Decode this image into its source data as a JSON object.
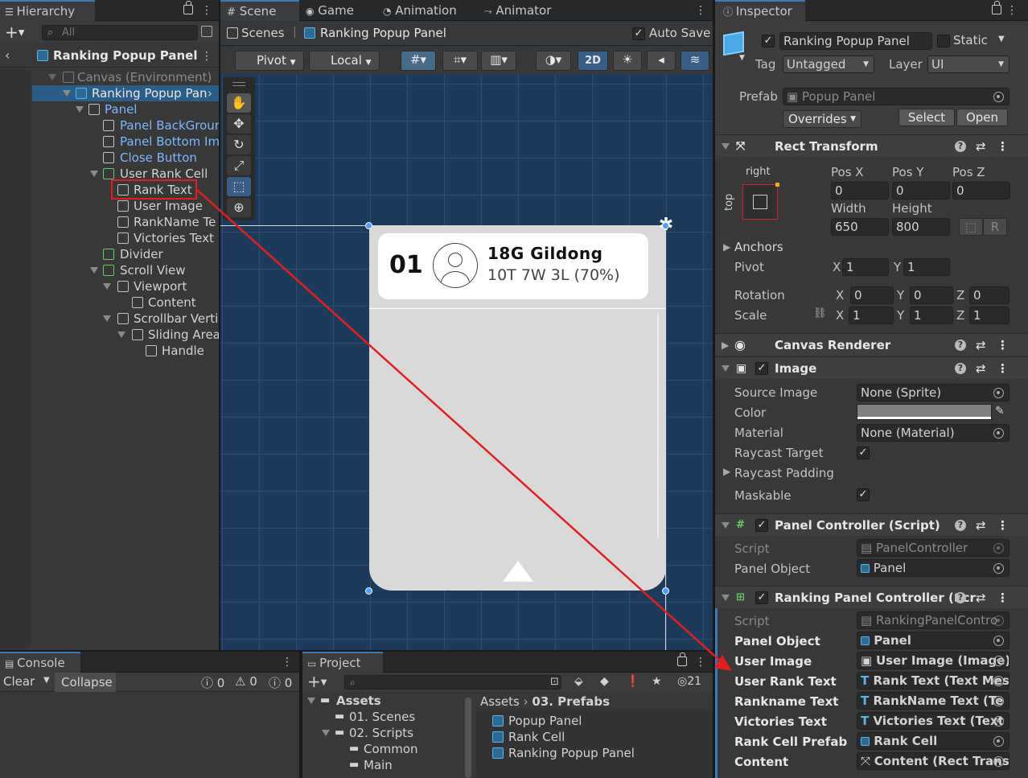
{
  "hierarchy": {
    "tab": "Hierarchy",
    "search_placeholder": "All",
    "title": "Ranking Popup Panel",
    "nodes": [
      {
        "label": "Canvas (Environment)"
      },
      {
        "label": "Ranking Popup Pan"
      },
      {
        "label": "Panel"
      },
      {
        "label": "Panel BackGrour"
      },
      {
        "label": "Panel Bottom Ima"
      },
      {
        "label": "Close Button"
      },
      {
        "label": "User Rank Cell"
      },
      {
        "label": "Rank Text"
      },
      {
        "label": "User Image"
      },
      {
        "label": "RankName Te"
      },
      {
        "label": "Victories Text"
      },
      {
        "label": "Divider"
      },
      {
        "label": "Scroll View"
      },
      {
        "label": "Viewport"
      },
      {
        "label": "Content"
      },
      {
        "label": "Scrollbar Verti"
      },
      {
        "label": "Sliding Area"
      },
      {
        "label": "Handle"
      }
    ]
  },
  "scene": {
    "tabs": [
      "Scene",
      "Game",
      "Animation",
      "Animator"
    ],
    "breadcrumb_root": "Scenes",
    "breadcrumb_current": "Ranking Popup Panel",
    "auto_save": "Auto Save",
    "pivot": "Pivot",
    "local": "Local",
    "mode_2d": "2D",
    "popup": {
      "rank": "01",
      "name": "18G Gildong",
      "record": "10T 7W 3L (70%)"
    }
  },
  "console": {
    "tab": "Console",
    "clear": "Clear",
    "collapse": "Collapse",
    "errors": "0",
    "warnings": "0",
    "infos": "0"
  },
  "project": {
    "tab": "Project",
    "count": "21",
    "tree": [
      {
        "label": "Assets"
      },
      {
        "label": "01. Scenes"
      },
      {
        "label": "02. Scripts"
      },
      {
        "label": "Common"
      },
      {
        "label": "Main"
      }
    ],
    "path_root": "Assets",
    "path_current": "03. Prefabs",
    "files": [
      {
        "label": "Popup Panel"
      },
      {
        "label": "Rank Cell"
      },
      {
        "label": "Ranking Popup Panel"
      }
    ]
  },
  "inspector": {
    "tab": "Inspector",
    "object_name": "Ranking Popup Panel",
    "static_label": "Static",
    "tag_label": "Tag",
    "tag_value": "Untagged",
    "layer_label": "Layer",
    "layer_value": "UI",
    "prefab_label": "Prefab",
    "prefab_value": "Popup Panel",
    "overrides": "Overrides",
    "select": "Select",
    "open": "Open",
    "rect_transform": {
      "title": "Rect Transform",
      "anchor_h": "right",
      "anchor_v": "top",
      "pos_x_label": "Pos X",
      "pos_x": "0",
      "pos_y_label": "Pos Y",
      "pos_y": "0",
      "pos_z_label": "Pos Z",
      "pos_z": "0",
      "width_label": "Width",
      "width": "650",
      "height_label": "Height",
      "height": "800",
      "r_label": "R",
      "anchors": "Anchors",
      "pivot": "Pivot",
      "pivot_x": "1",
      "pivot_y": "1",
      "rotation": "Rotation",
      "rot_x": "0",
      "rot_y": "0",
      "rot_z": "0",
      "scale": "Scale",
      "scale_x": "1",
      "scale_y": "1",
      "scale_z": "1",
      "x": "X",
      "y": "Y",
      "z": "Z"
    },
    "canvas_renderer": "Canvas Renderer",
    "image": {
      "title": "Image",
      "source_image_label": "Source Image",
      "source_image": "None (Sprite)",
      "color_label": "Color",
      "color": "#808080",
      "material_label": "Material",
      "material": "None (Material)",
      "raycast_target": "Raycast Target",
      "raycast_padding": "Raycast Padding",
      "maskable": "Maskable"
    },
    "panel_controller": {
      "title": "Panel Controller (Script)",
      "script_label": "Script",
      "script": "PanelController",
      "panel_object_label": "Panel Object",
      "panel_object": "Panel"
    },
    "ranking_controller": {
      "title": "Ranking Panel Controller (Scr",
      "script_label": "Script",
      "script": "RankingPanelContro",
      "fields": [
        {
          "label": "Panel Object",
          "value": "Panel"
        },
        {
          "label": "User Image",
          "value": "User Image (Image)"
        },
        {
          "label": "User Rank Text",
          "value": "Rank Text (Text Mes"
        },
        {
          "label": "Rankname Text",
          "value": "RankName Text (Te"
        },
        {
          "label": "Victories Text",
          "value": "Victories Text (Text"
        },
        {
          "label": "Rank Cell Prefab",
          "value": "Rank Cell"
        },
        {
          "label": "Content",
          "value": "Content (Rect Trans"
        }
      ]
    }
  },
  "colors": {
    "accent": "#3a79bb",
    "annotation": "#e02020",
    "scene_bg": "#1e3a5a"
  }
}
